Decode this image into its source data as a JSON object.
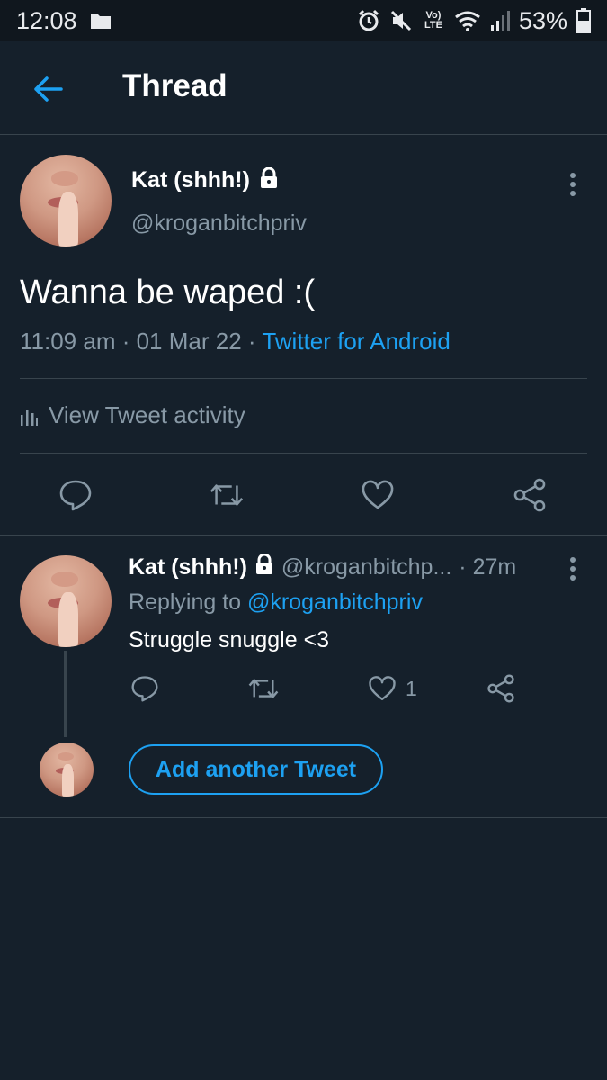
{
  "status_bar": {
    "time": "12:08",
    "network_label": "Vo) LTE",
    "battery": "53%",
    "icons": [
      "folder-icon",
      "alarm-icon",
      "mute-icon",
      "volte-icon",
      "wifi-icon",
      "signal-icon",
      "battery-icon"
    ]
  },
  "header": {
    "back_icon": "back-arrow-icon",
    "title": "Thread"
  },
  "main_tweet": {
    "display_name": "Kat (shhh!)",
    "protected_icon": "lock-icon",
    "handle": "@kroganbitchpriv",
    "text": "Wanna be waped :(",
    "time": "11:09 am",
    "sep1": " · ",
    "date": "01 Mar 22",
    "sep2": " · ",
    "source": "Twitter for Android",
    "activity_label": "View Tweet activity",
    "actions": [
      "reply-icon",
      "retweet-icon",
      "like-icon",
      "share-icon"
    ]
  },
  "reply": {
    "display_name": "Kat (shhh!)",
    "handle": "@kroganbitchp...",
    "age": "· 27m",
    "replying_prefix": "Replying to ",
    "replying_to": "@kroganbitchpriv",
    "text": "Struggle snuggle <3",
    "like_count": "1",
    "add_button": "Add another Tweet"
  },
  "colors": {
    "background": "#15202b",
    "accent": "#1da1f2",
    "muted": "#8899a6",
    "divider": "#38444d"
  }
}
